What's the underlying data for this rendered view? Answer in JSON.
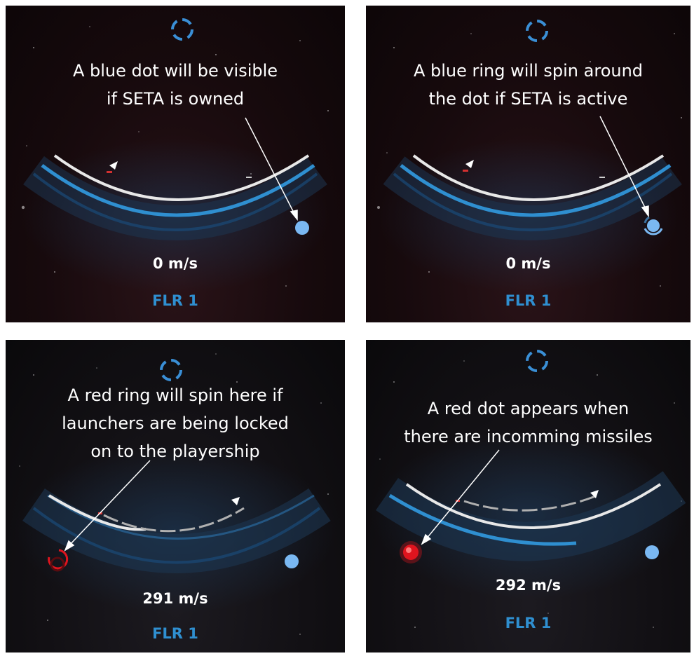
{
  "panels": [
    {
      "caption": [
        "A blue dot will be visible",
        "if SETA is owned"
      ],
      "speed": "0 m/s",
      "mode": "FLR 1",
      "seta_indicator": "blue-dot",
      "threat_indicator": "none"
    },
    {
      "caption": [
        "A blue ring will spin around",
        "the dot if SETA is active"
      ],
      "speed": "0 m/s",
      "mode": "FLR 1",
      "seta_indicator": "blue-dot-with-spinning-ring",
      "threat_indicator": "none"
    },
    {
      "caption": [
        "A red ring will spin here if",
        "launchers are being locked",
        "on to the playership"
      ],
      "speed": "291 m/s",
      "mode": "FLR 1",
      "seta_indicator": "blue-dot",
      "threat_indicator": "red-spinning-ring"
    },
    {
      "caption": [
        "A red dot appears when",
        "there are incomming missiles"
      ],
      "speed": "292 m/s",
      "mode": "FLR 1",
      "seta_indicator": "blue-dot",
      "threat_indicator": "red-dot"
    }
  ],
  "colors": {
    "background": "#150a0c",
    "accent_blue": "#2f8fd0",
    "seta_blue": "#7ab8f2",
    "alert_red": "#e0141e",
    "arc_white": "#e8e8e8"
  },
  "icons": {
    "target_reticle": "dashed-circle-reticle-icon",
    "ship_marker": "white-triangle-icon"
  }
}
